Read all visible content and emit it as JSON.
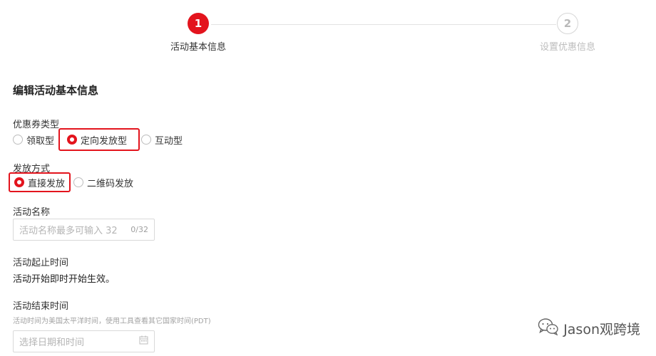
{
  "stepper": {
    "steps": [
      {
        "number": "1",
        "label": "活动基本信息"
      },
      {
        "number": "2",
        "label": "设置优惠信息"
      }
    ]
  },
  "form": {
    "section_title": "编辑活动基本信息",
    "coupon_type": {
      "label": "优惠券类型",
      "options": [
        "领取型",
        "定向发放型",
        "互动型"
      ],
      "selected": "定向发放型"
    },
    "issue_method": {
      "label": "发放方式",
      "options": [
        "直接发放",
        "二维码发放"
      ],
      "selected": "直接发放"
    },
    "activity_name": {
      "label": "活动名称",
      "placeholder": "活动名称最多可输入 32",
      "counter": "0/32"
    },
    "start_time": {
      "label": "活动起止时间",
      "value": "活动开始即时开始生效。"
    },
    "end_time": {
      "label": "活动结束时间",
      "hint": "活动时间为美国太平洋时间，使用工具查看其它国家时间(PDT)",
      "placeholder": "选择日期和时间"
    }
  },
  "watermark": {
    "text": "Jason观跨境"
  },
  "colors": {
    "accent": "#e3141d",
    "border": "#d9d9d9",
    "placeholder": "#b5b5b5"
  }
}
